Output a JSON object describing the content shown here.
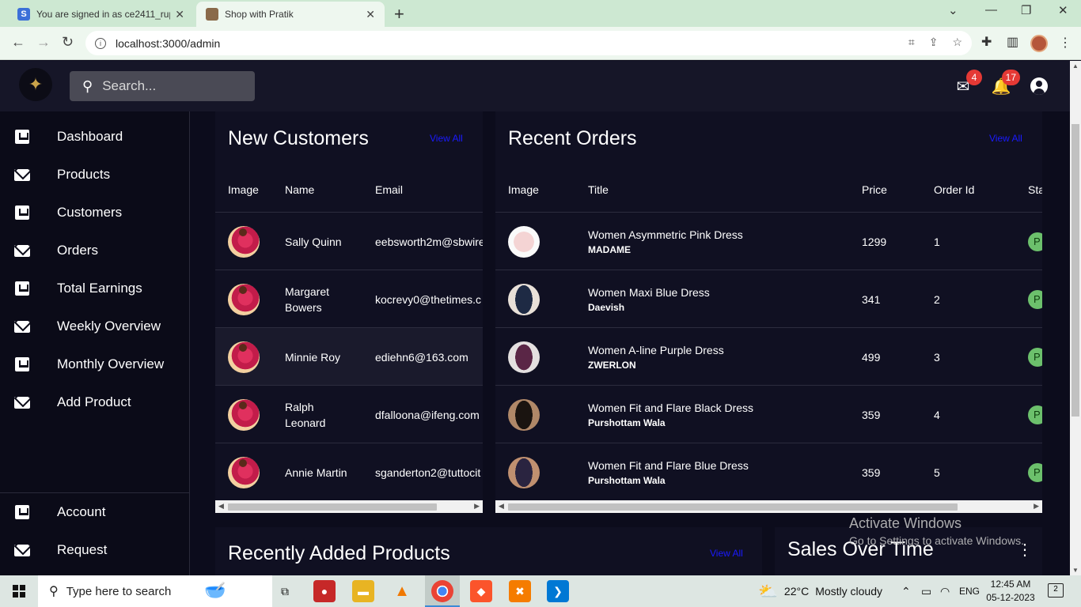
{
  "browser": {
    "tabs": [
      {
        "title": "You are signed in as ce2411_rup",
        "favicon": "S",
        "active": false
      },
      {
        "title": "Shop with Pratik",
        "active": true
      }
    ],
    "url": "localhost:3000/admin"
  },
  "header": {
    "search_placeholder": "Search...",
    "mail_badge": "4",
    "notification_badge": "17"
  },
  "sidebar": {
    "items": [
      {
        "label": "Dashboard",
        "icon": "inbox-icon"
      },
      {
        "label": "Products",
        "icon": "mail-icon"
      },
      {
        "label": "Customers",
        "icon": "inbox-icon"
      },
      {
        "label": "Orders",
        "icon": "mail-icon"
      },
      {
        "label": "Total Earnings",
        "icon": "inbox-icon"
      },
      {
        "label": "Weekly Overview",
        "icon": "mail-icon"
      },
      {
        "label": "Monthly Overview",
        "icon": "inbox-icon"
      },
      {
        "label": "Add Product",
        "icon": "mail-icon"
      }
    ],
    "bottom_items": [
      {
        "label": "Account",
        "icon": "inbox-icon"
      },
      {
        "label": "Request",
        "icon": "mail-icon"
      }
    ]
  },
  "customers": {
    "title": "New Customers",
    "view_all": "View All",
    "columns": [
      "Image",
      "Name",
      "Email"
    ],
    "rows": [
      {
        "name": "Sally Quinn",
        "email": "eebsworth2m@sbwire"
      },
      {
        "name": "Margaret Bowers",
        "email": "kocrevy0@thetimes.c"
      },
      {
        "name": "Minnie Roy",
        "email": "ediehn6@163.com"
      },
      {
        "name": "Ralph Leonard",
        "email": "dfalloona@ifeng.com"
      },
      {
        "name": "Annie Martin",
        "email": "sganderton2@tuttocit"
      }
    ]
  },
  "orders": {
    "title": "Recent Orders",
    "view_all": "View All",
    "columns": [
      "Image",
      "Title",
      "Price",
      "Order Id",
      "Sta"
    ],
    "rows": [
      {
        "title": "Women Asymmetric Pink Dress",
        "brand": "MADAME",
        "price": "1299",
        "order_id": "1",
        "status": "P",
        "color": "#f1c9c9"
      },
      {
        "title": "Women Maxi Blue Dress",
        "brand": "Daevish",
        "price": "341",
        "order_id": "2",
        "status": "P",
        "color": "#1e2a44"
      },
      {
        "title": "Women A-line Purple Dress",
        "brand": "ZWERLON",
        "price": "499",
        "order_id": "3",
        "status": "P",
        "color": "#5a2646"
      },
      {
        "title": "Women Fit and Flare Black Dress",
        "brand": "Purshottam Wala",
        "price": "359",
        "order_id": "4",
        "status": "P",
        "color": "#3a2216"
      },
      {
        "title": "Women Fit and Flare Blue Dress",
        "brand": "Purshottam Wala",
        "price": "359",
        "order_id": "5",
        "status": "P",
        "color": "#2a2440"
      }
    ]
  },
  "products_card": {
    "title": "Recently Added Products",
    "view_all": "View All"
  },
  "sales_card": {
    "title": "Sales Over Time"
  },
  "watermark": {
    "line1": "Activate Windows",
    "line2": "Go to Settings to activate Windows."
  },
  "taskbar": {
    "search_placeholder": "Type here to search",
    "weather_temp": "22°C",
    "weather_desc": "Mostly cloudy",
    "language": "ENG",
    "time": "12:45 AM",
    "date": "05-12-2023",
    "notification_count": "2"
  },
  "colors": {
    "accent_link": "#1a1aff",
    "badge_red": "#e53935",
    "status_green": "#6cc06c",
    "background": "#0c0c1c"
  }
}
